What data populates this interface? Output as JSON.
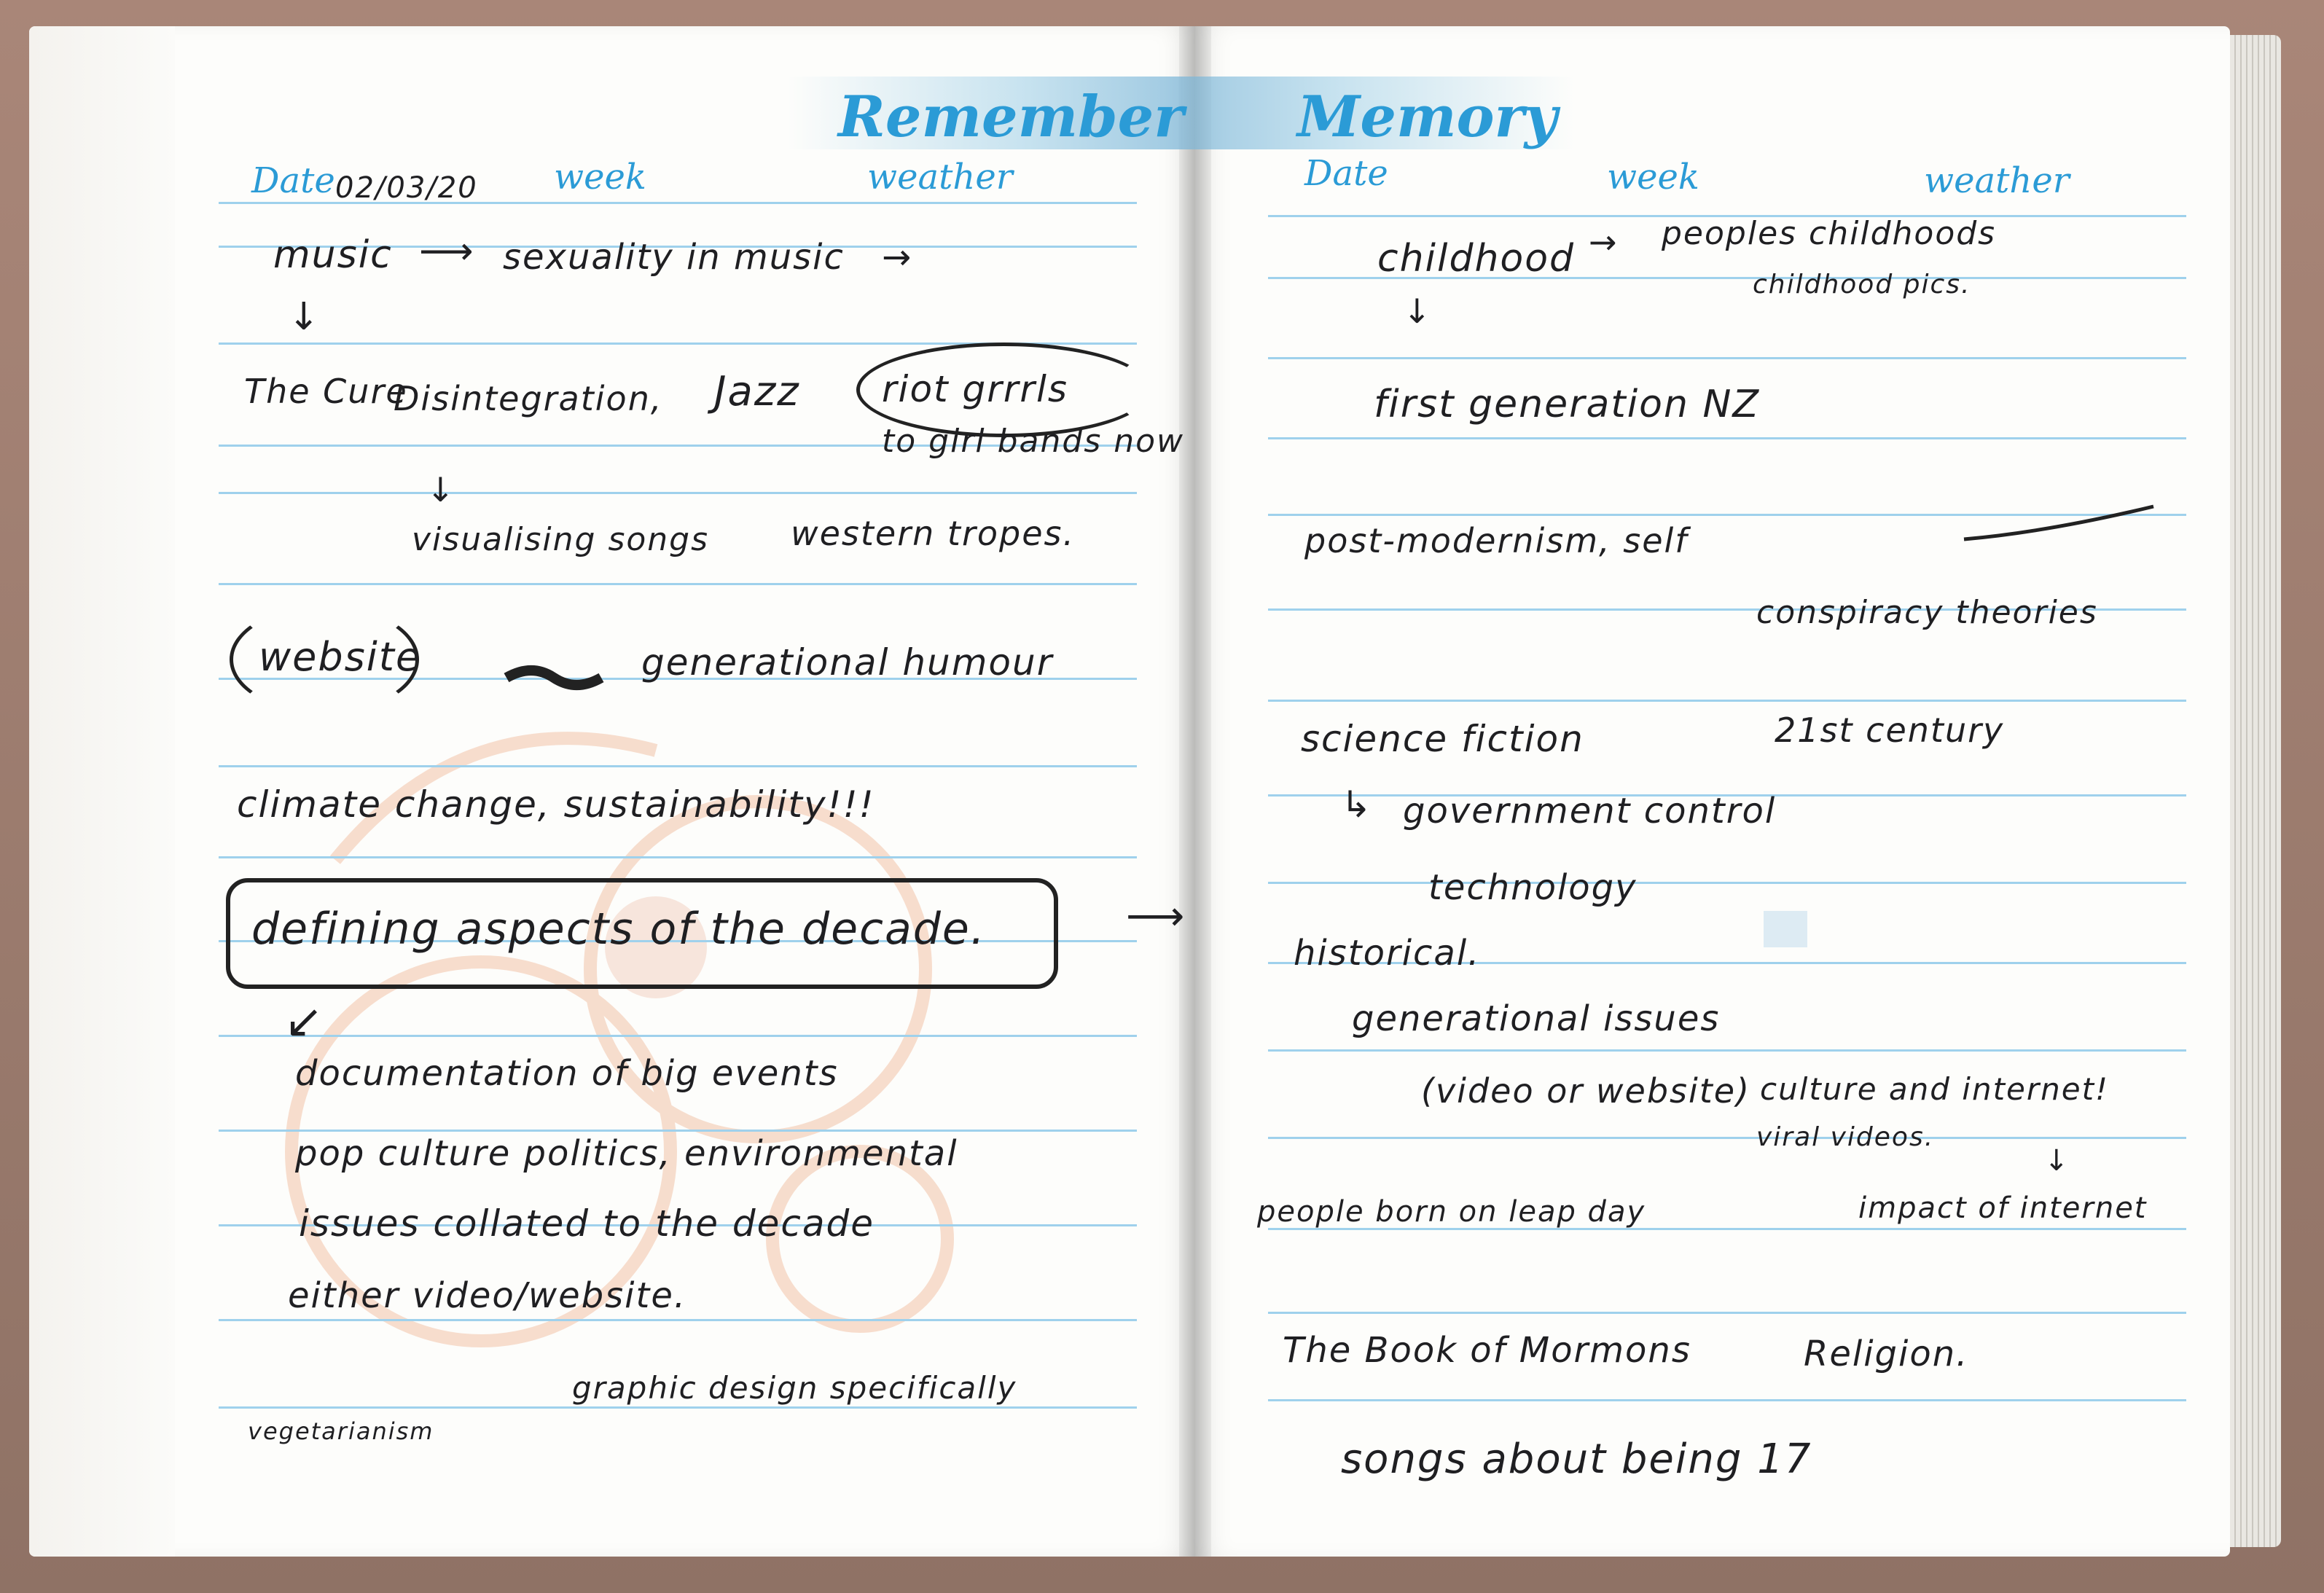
{
  "header": {
    "left_title": "Remember",
    "right_title": "Memory",
    "date_label": "Date",
    "week_label": "week",
    "weather_label": "weather",
    "left_date_value": "02/03/20"
  },
  "left_page": {
    "lines": [
      "music",
      "sexuality in music",
      "The Cure",
      "Disintegration,",
      "Jazz",
      "riot grrrls",
      "to girl bands now",
      "visualising songs",
      "western tropes.",
      "website",
      "generational humour",
      "climate change, sustainability!!!",
      "defining aspects of the decade.",
      "documentation of big events",
      "pop culture politics, environmental",
      "issues collated to the decade",
      "either video/website.",
      "graphic design specifically",
      "vegetarianism"
    ]
  },
  "right_page": {
    "lines": [
      "childhood",
      "peoples childhoods",
      "childhood pics.",
      "first generation NZ",
      "post-modernism, self",
      "conspiracy theories",
      "science fiction",
      "21st century",
      "government control",
      "technology",
      "historical.",
      "generational issues",
      "(video or website)",
      "culture and internet!",
      "viral videos.",
      "people born on leap day",
      "impact of internet",
      "The Book of Mormons",
      "Religion.",
      "songs about being 17"
    ]
  },
  "colors": {
    "rule_line": "#9fd1ec",
    "header_blue": "#2b9bd6",
    "ink": "#1f1f22"
  }
}
